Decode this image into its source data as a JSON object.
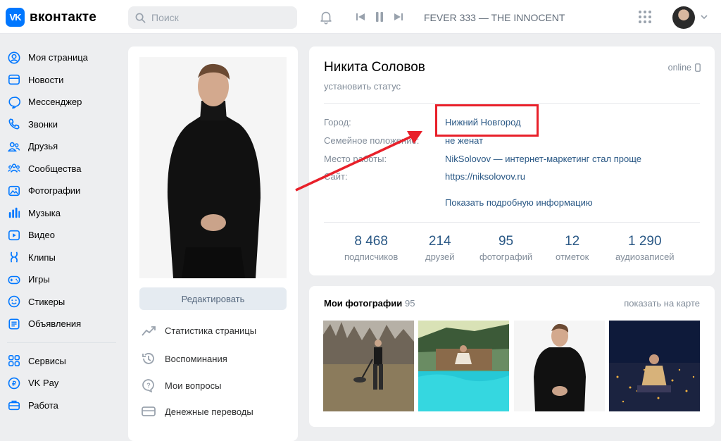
{
  "header": {
    "logo_text": "вконтакте",
    "logo_mark": "VK",
    "search_placeholder": "Поиск",
    "track": "FEVER 333 — THE INNOCENT"
  },
  "sidebar": {
    "items": [
      {
        "label": "Моя страница",
        "icon": "user-circle-icon"
      },
      {
        "label": "Новости",
        "icon": "news-icon"
      },
      {
        "label": "Мессенджер",
        "icon": "message-icon"
      },
      {
        "label": "Звонки",
        "icon": "phone-icon"
      },
      {
        "label": "Друзья",
        "icon": "friends-icon"
      },
      {
        "label": "Сообщества",
        "icon": "communities-icon"
      },
      {
        "label": "Фотографии",
        "icon": "photo-icon"
      },
      {
        "label": "Музыка",
        "icon": "music-icon"
      },
      {
        "label": "Видео",
        "icon": "video-icon"
      },
      {
        "label": "Клипы",
        "icon": "clips-icon"
      },
      {
        "label": "Игры",
        "icon": "gamepad-icon"
      },
      {
        "label": "Стикеры",
        "icon": "smile-icon"
      },
      {
        "label": "Объявления",
        "icon": "ads-icon"
      }
    ],
    "items2": [
      {
        "label": "Сервисы",
        "icon": "services-icon"
      },
      {
        "label": "VK Pay",
        "icon": "vkpay-icon"
      },
      {
        "label": "Работа",
        "icon": "briefcase-icon"
      }
    ]
  },
  "left_column": {
    "edit_button": "Редактировать",
    "menu": [
      {
        "label": "Статистика страницы",
        "icon": "stats-icon"
      },
      {
        "label": "Воспоминания",
        "icon": "memories-icon"
      },
      {
        "label": "Мои вопросы",
        "icon": "question-icon"
      },
      {
        "label": "Денежные переводы",
        "icon": "money-transfer-icon"
      }
    ]
  },
  "profile": {
    "name": "Никита Соловов",
    "status": "установить статус",
    "online": "online",
    "info": [
      {
        "label": "Город:",
        "value": "Нижний Новгород"
      },
      {
        "label": "Семейное положение:",
        "value": "не женат"
      },
      {
        "label": "Место работы:",
        "value": "NikSolovov — интернет-маркетинг стал проще"
      },
      {
        "label": "Сайт:",
        "value": "https://niksolovov.ru"
      }
    ],
    "more_info": "Показать подробную информацию",
    "stats": [
      {
        "num": "8 468",
        "label": "подписчиков"
      },
      {
        "num": "214",
        "label": "друзей"
      },
      {
        "num": "95",
        "label": "фотографий"
      },
      {
        "num": "12",
        "label": "отметок"
      },
      {
        "num": "1 290",
        "label": "аудиозаписей"
      }
    ]
  },
  "photos": {
    "title": "Мои фотографии",
    "count": "95",
    "map_link": "показать на карте"
  },
  "colors": {
    "accent": "#0077ff",
    "link": "#2a5885",
    "highlight": "#e8202a"
  }
}
